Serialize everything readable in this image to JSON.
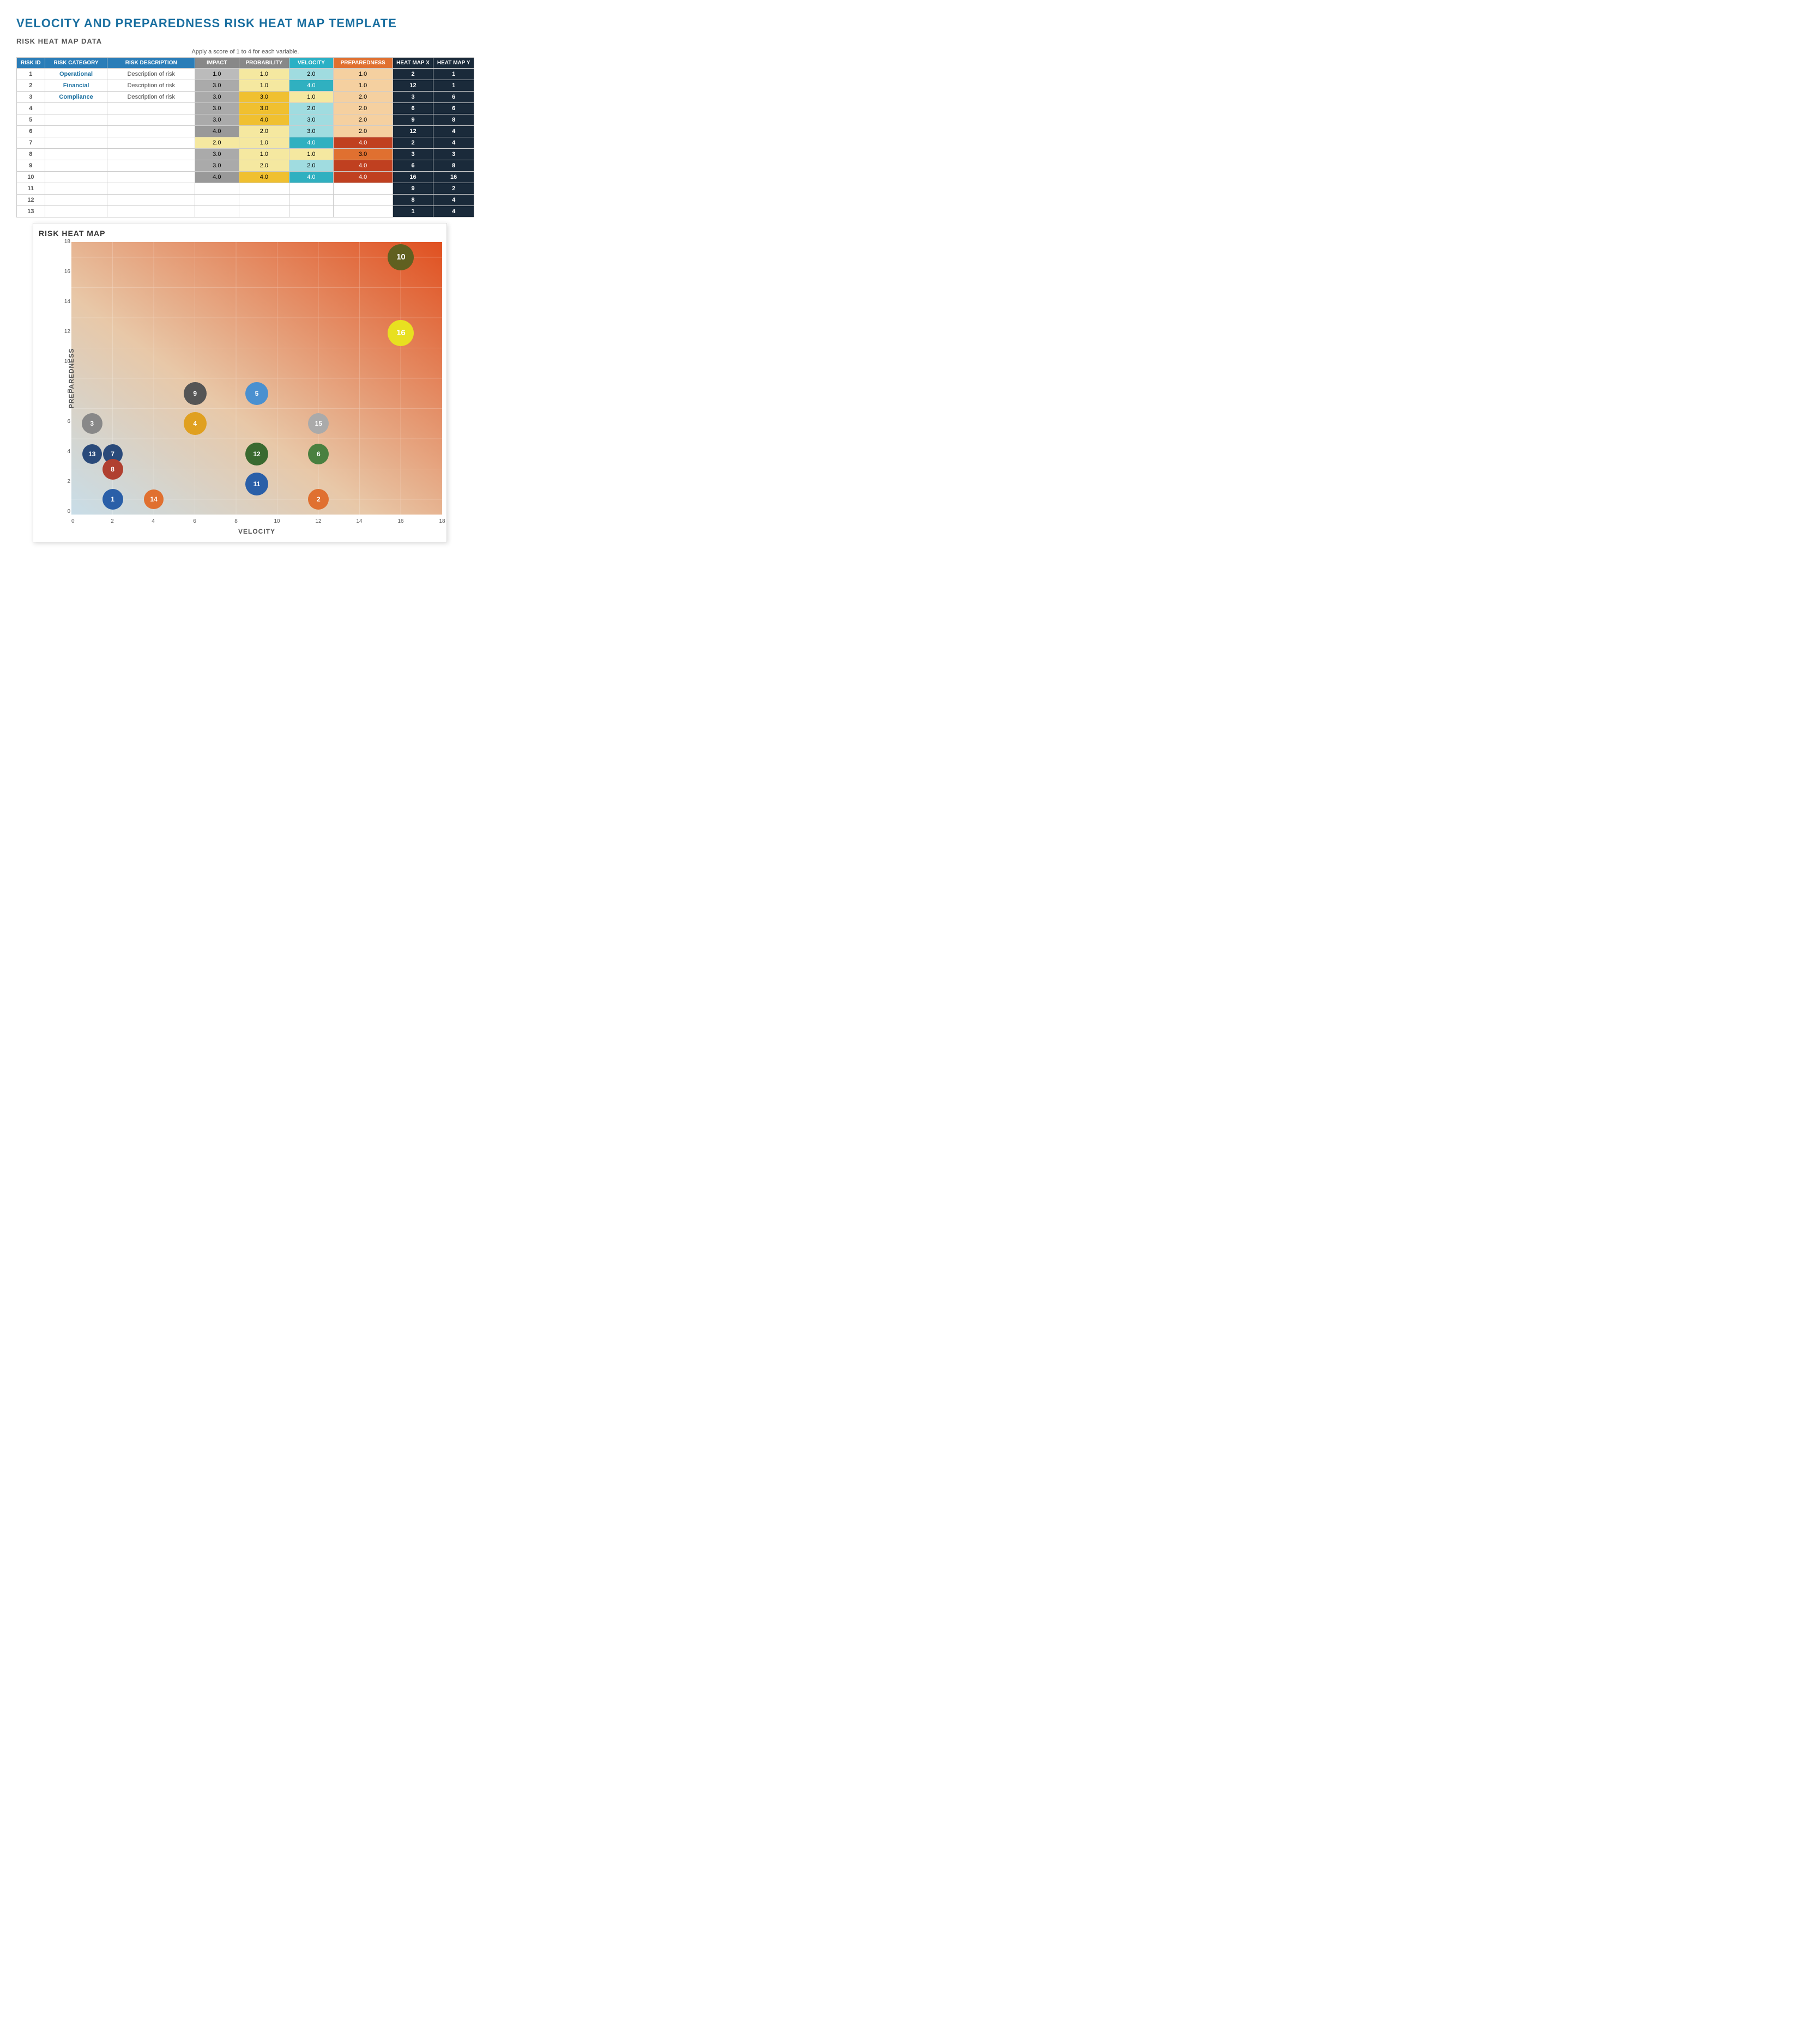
{
  "title": "VELOCITY AND PREPAREDNESS RISK HEAT MAP TEMPLATE",
  "dataSection": {
    "label": "RISK HEAT MAP DATA",
    "note": "Apply a score of 1 to 4 for each variable.",
    "headers": {
      "riskId": "RISK ID",
      "riskCategory": "RISK CATEGORY",
      "riskDescription": "RISK DESCRIPTION",
      "impact": "IMPACT",
      "probability": "PROBABILITY",
      "velocity": "VELOCITY",
      "preparedness": "PREPAREDNESS",
      "heatMapX": "HEAT MAP X",
      "heatMapY": "HEAT MAP Y"
    },
    "rows": [
      {
        "id": 1,
        "category": "Operational",
        "description": "Description of risk",
        "impact": 1.0,
        "probability": 1.0,
        "velocity": 2.0,
        "preparedness": 1.0,
        "heatX": 2,
        "heatY": 1
      },
      {
        "id": 2,
        "category": "Financial",
        "description": "Description of risk",
        "impact": 3.0,
        "probability": 1.0,
        "velocity": 4.0,
        "preparedness": 1.0,
        "heatX": 12,
        "heatY": 1
      },
      {
        "id": 3,
        "category": "Compliance",
        "description": "Description of risk",
        "impact": 3.0,
        "probability": 3.0,
        "velocity": 1.0,
        "preparedness": 2.0,
        "heatX": 3,
        "heatY": 6
      },
      {
        "id": 4,
        "category": "",
        "description": "",
        "impact": 3.0,
        "probability": 3.0,
        "velocity": 2.0,
        "preparedness": 2.0,
        "heatX": 6,
        "heatY": 6
      },
      {
        "id": 5,
        "category": "",
        "description": "",
        "impact": 3.0,
        "probability": 4.0,
        "velocity": 3.0,
        "preparedness": 2.0,
        "heatX": 9,
        "heatY": 8
      },
      {
        "id": 6,
        "category": "",
        "description": "",
        "impact": 4.0,
        "probability": 2.0,
        "velocity": 3.0,
        "preparedness": 2.0,
        "heatX": 12,
        "heatY": 4
      },
      {
        "id": 7,
        "category": "",
        "description": "",
        "impact": 2.0,
        "probability": 1.0,
        "velocity": 4.0,
        "preparedness": 4.0,
        "heatX": 2,
        "heatY": 4
      },
      {
        "id": 8,
        "category": "",
        "description": "",
        "impact": 3.0,
        "probability": 1.0,
        "velocity": 1.0,
        "preparedness": 3.0,
        "heatX": 3,
        "heatY": 3
      },
      {
        "id": 9,
        "category": "",
        "description": "",
        "impact": 3.0,
        "probability": 2.0,
        "velocity": 2.0,
        "preparedness": 4.0,
        "heatX": 6,
        "heatY": 8
      },
      {
        "id": 10,
        "category": "",
        "description": "",
        "impact": 4.0,
        "probability": 4.0,
        "velocity": 4.0,
        "preparedness": 4.0,
        "heatX": 16,
        "heatY": 16
      },
      {
        "id": 11,
        "category": "",
        "description": "",
        "impact": null,
        "probability": null,
        "velocity": null,
        "preparedness": null,
        "heatX": 9,
        "heatY": 2
      },
      {
        "id": 12,
        "category": "",
        "description": "",
        "impact": null,
        "probability": null,
        "velocity": null,
        "preparedness": null,
        "heatX": 8,
        "heatY": 4
      },
      {
        "id": 13,
        "category": "",
        "description": "",
        "impact": null,
        "probability": null,
        "velocity": null,
        "preparedness": null,
        "heatX": 1,
        "heatY": 4
      }
    ]
  },
  "chart": {
    "title": "RISK HEAT MAP",
    "xAxisLabel": "VELOCITY",
    "yAxisLabel": "PREPAREDNESS",
    "xTicks": [
      0,
      2,
      4,
      6,
      8,
      10,
      12,
      14,
      16,
      18
    ],
    "yTicks": [
      0,
      2,
      4,
      6,
      8,
      10,
      12,
      14,
      16,
      18
    ],
    "bubbles": [
      {
        "id": 1,
        "x": 2,
        "y": 1,
        "size": 38,
        "color": "#2a5fa8"
      },
      {
        "id": 2,
        "x": 12,
        "y": 1,
        "size": 38,
        "color": "#e07030"
      },
      {
        "id": 3,
        "x": 1,
        "y": 6,
        "size": 38,
        "color": "#888"
      },
      {
        "id": 4,
        "x": 6,
        "y": 6,
        "size": 42,
        "color": "#e0a020"
      },
      {
        "id": 5,
        "x": 9,
        "y": 8,
        "size": 42,
        "color": "#4a90d0"
      },
      {
        "id": 6,
        "x": 12,
        "y": 4,
        "size": 38,
        "color": "#4a8040"
      },
      {
        "id": 7,
        "x": 2,
        "y": 4,
        "size": 36,
        "color": "#2a4a7a"
      },
      {
        "id": 8,
        "x": 2,
        "y": 3,
        "size": 38,
        "color": "#b04030"
      },
      {
        "id": 9,
        "x": 6,
        "y": 8,
        "size": 42,
        "color": "#555"
      },
      {
        "id": 10,
        "x": 16,
        "y": 17,
        "size": 48,
        "color": "#606020"
      },
      {
        "id": 11,
        "x": 9,
        "y": 2,
        "size": 42,
        "color": "#2a5fa8"
      },
      {
        "id": 12,
        "x": 9,
        "y": 4,
        "size": 42,
        "color": "#3a6a30"
      },
      {
        "id": 13,
        "x": 1,
        "y": 4,
        "size": 36,
        "color": "#2a4a7a"
      },
      {
        "id": 14,
        "x": 4,
        "y": 1,
        "size": 36,
        "color": "#e07030"
      },
      {
        "id": 15,
        "x": 12,
        "y": 6,
        "size": 38,
        "color": "#aaa"
      },
      {
        "id": 16,
        "x": 16,
        "y": 12,
        "size": 48,
        "color": "#e8e020"
      }
    ]
  }
}
